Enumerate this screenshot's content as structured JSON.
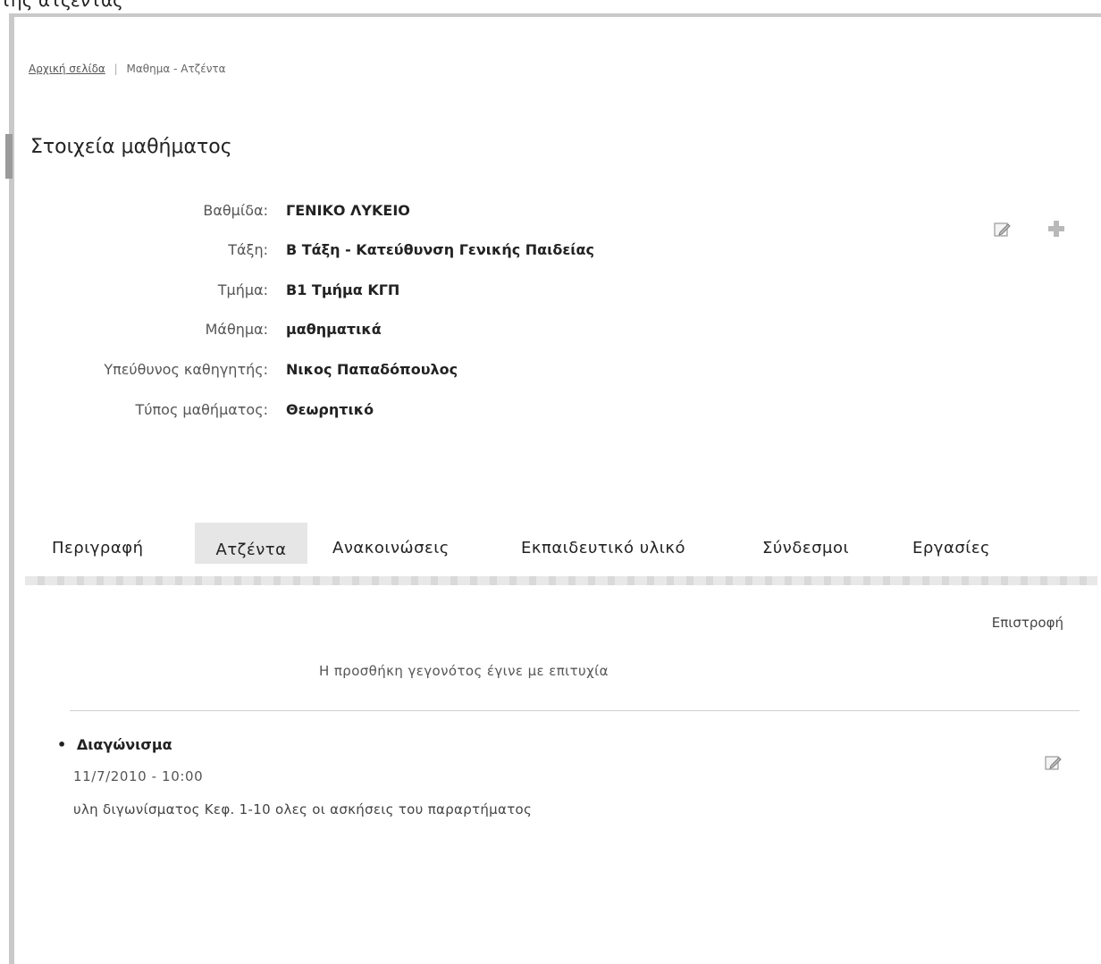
{
  "header_cut_text": "της ατζέντας",
  "breadcrumb": {
    "home": "Αρχική σελίδα",
    "separator": "|",
    "current": "Μαθημα - Ατζέντα"
  },
  "page_title": "Στοιχεία μαθήματος",
  "course": {
    "fields": [
      {
        "label": "Βαθμίδα:",
        "value": "ΓΕΝΙΚΟ ΛΥΚΕΙΟ"
      },
      {
        "label": "Τάξη:",
        "value": "Β Τάξη - Κατεύθυνση Γενικής Παιδείας"
      },
      {
        "label": "Τμήμα:",
        "value": "Β1 Τμήμα ΚΓΠ"
      },
      {
        "label": "Μάθημα:",
        "value": "μαθηματικά"
      },
      {
        "label": "Υπεύθυνος καθηγητής:",
        "value": "Νικος Παπαδόπουλος"
      },
      {
        "label": "Τύπος μαθήματος:",
        "value": "Θεωρητικό"
      }
    ],
    "icons": {
      "edit": "edit-icon",
      "add": "plus-icon"
    }
  },
  "tabs": [
    {
      "label": "Περιγραφή",
      "active": false
    },
    {
      "label": "Ατζέντα",
      "active": true
    },
    {
      "label": "Ανακοινώσεις",
      "active": false
    },
    {
      "label": "Εκπαιδευτικό υλικό",
      "active": false
    },
    {
      "label": "Σύνδεσμοι",
      "active": false
    },
    {
      "label": "Εργασίες",
      "active": false
    }
  ],
  "return_label": "Επιστροφή",
  "success_message": "Η προσθήκη γεγονότος έγινε με επιτυχία",
  "events": [
    {
      "bullet": "•",
      "title": "Διαγώνισμα",
      "datetime": "11/7/2010 - 10:00",
      "description": "υλη διγωνίσματος Κεφ. 1-10 ολες οι ασκήσεις του παραρτήματος"
    }
  ]
}
